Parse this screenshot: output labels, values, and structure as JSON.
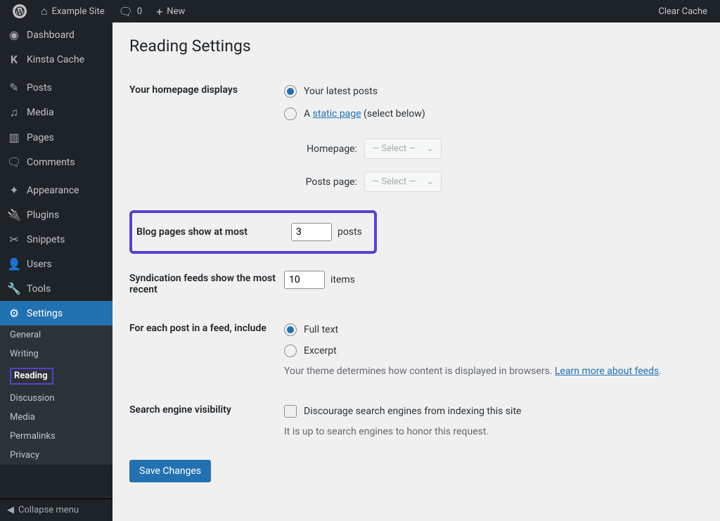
{
  "adminbar": {
    "site_name": "Example Site",
    "comments_count": "0",
    "new_label": "New",
    "clear_cache": "Clear Cache"
  },
  "sidebar": {
    "items": [
      {
        "label": "Dashboard"
      },
      {
        "label": "Kinsta Cache"
      },
      {
        "label": "Posts"
      },
      {
        "label": "Media"
      },
      {
        "label": "Pages"
      },
      {
        "label": "Comments"
      },
      {
        "label": "Appearance"
      },
      {
        "label": "Plugins"
      },
      {
        "label": "Snippets"
      },
      {
        "label": "Users"
      },
      {
        "label": "Tools"
      },
      {
        "label": "Settings"
      }
    ],
    "sub": [
      {
        "label": "General"
      },
      {
        "label": "Writing"
      },
      {
        "label": "Reading"
      },
      {
        "label": "Discussion"
      },
      {
        "label": "Media"
      },
      {
        "label": "Permalinks"
      },
      {
        "label": "Privacy"
      }
    ],
    "collapse": "Collapse menu"
  },
  "page": {
    "title": "Reading Settings",
    "homepage_displays_label": "Your homepage displays",
    "latest_posts": "Your latest posts",
    "static_page_prefix": "A ",
    "static_page_link": "static page",
    "static_page_suffix": " (select below)",
    "homepage_label": "Homepage:",
    "posts_page_label": "Posts page:",
    "select_placeholder": "— Select —",
    "blog_pages_label": "Blog pages show at most",
    "blog_pages_value": "3",
    "blog_pages_suffix": "posts",
    "syndication_label": "Syndication feeds show the most recent",
    "syndication_value": "10",
    "syndication_suffix": "items",
    "feed_include_label": "For each post in a feed, include",
    "feed_full_text": "Full text",
    "feed_excerpt": "Excerpt",
    "feed_desc_prefix": "Your theme determines how content is displayed in browsers. ",
    "feed_desc_link": "Learn more about feeds",
    "feed_desc_suffix": ".",
    "search_visibility_label": "Search engine visibility",
    "search_checkbox_label": "Discourage search engines from indexing this site",
    "search_desc": "It is up to search engines to honor this request.",
    "save_button": "Save Changes"
  }
}
